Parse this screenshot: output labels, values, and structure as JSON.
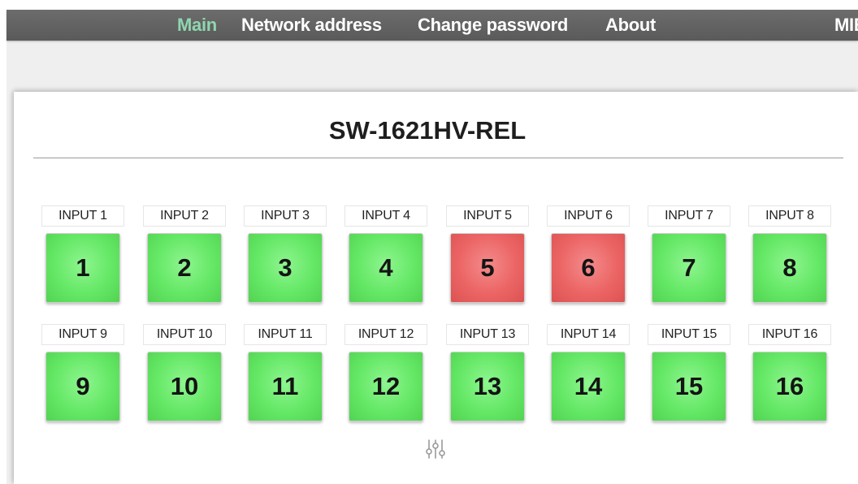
{
  "nav": {
    "items": [
      {
        "label": "Main",
        "active": true
      },
      {
        "label": "Network address",
        "active": false
      },
      {
        "label": "Change password",
        "active": false
      },
      {
        "label": "About",
        "active": false
      }
    ],
    "right_label": "MIE"
  },
  "device": {
    "title": "SW-1621HV-REL"
  },
  "inputs": [
    {
      "label": "INPUT 1",
      "number": "1",
      "state": "on"
    },
    {
      "label": "INPUT 2",
      "number": "2",
      "state": "on"
    },
    {
      "label": "INPUT 3",
      "number": "3",
      "state": "on"
    },
    {
      "label": "INPUT 4",
      "number": "4",
      "state": "on"
    },
    {
      "label": "INPUT 5",
      "number": "5",
      "state": "off"
    },
    {
      "label": "INPUT 6",
      "number": "6",
      "state": "off"
    },
    {
      "label": "INPUT 7",
      "number": "7",
      "state": "on"
    },
    {
      "label": "INPUT 8",
      "number": "8",
      "state": "on"
    },
    {
      "label": "INPUT 9",
      "number": "9",
      "state": "on"
    },
    {
      "label": "INPUT 10",
      "number": "10",
      "state": "on"
    },
    {
      "label": "INPUT 11",
      "number": "11",
      "state": "on"
    },
    {
      "label": "INPUT 12",
      "number": "12",
      "state": "on"
    },
    {
      "label": "INPUT 13",
      "number": "13",
      "state": "on"
    },
    {
      "label": "INPUT 14",
      "number": "14",
      "state": "on"
    },
    {
      "label": "INPUT 15",
      "number": "15",
      "state": "on"
    },
    {
      "label": "INPUT 16",
      "number": "16",
      "state": "on"
    }
  ],
  "colors": {
    "nav_background": "#606060",
    "nav_active_text": "#8fd6b0",
    "button_on": "#65e866",
    "button_off": "#ec6565"
  },
  "settings": {
    "icon": "sliders-icon"
  }
}
